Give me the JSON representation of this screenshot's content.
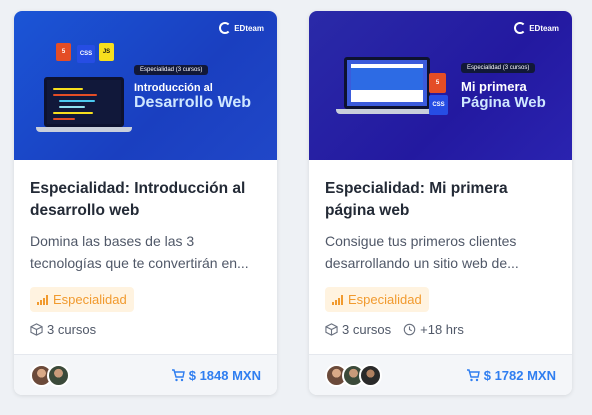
{
  "cards": [
    {
      "banner": {
        "brand": "EDteam",
        "pill": "Especialidad (3 cursos)",
        "headline_1": "Introducción al",
        "headline_2": "Desarrollo Web",
        "logos": [
          "5",
          "CSS",
          "JS"
        ]
      },
      "title": "Especialidad: Introducción al desarrollo web",
      "description": "Domina las bases de las 3 tecnologías que te convertirán en...",
      "tag": "Especialidad",
      "courses": "3 cursos",
      "price": "$ 1848 MXN",
      "avatar_colors": [
        "#6b4a3a",
        "#3b4a3a"
      ]
    },
    {
      "banner": {
        "brand": "EDteam",
        "pill": "Especialidad (3 cursos)",
        "headline_1": "Mi primera",
        "headline_2": "Página Web",
        "logos": [
          "5",
          "CSS"
        ]
      },
      "title": "Especialidad: Mi primera página web",
      "description": "Consigue tus primeros clientes desarrollando un sitio web de...",
      "tag": "Especialidad",
      "courses": "3 cursos",
      "hours": "+18 hrs",
      "price": "$ 1782 MXN",
      "avatar_colors": [
        "#6b4a3a",
        "#3b4a3a",
        "#2a2a2a"
      ]
    }
  ],
  "colors": {
    "accent": "#2f7ef0",
    "tag_text": "#f19a2e",
    "tag_bg": "#fff3e0",
    "title": "#232a36"
  }
}
